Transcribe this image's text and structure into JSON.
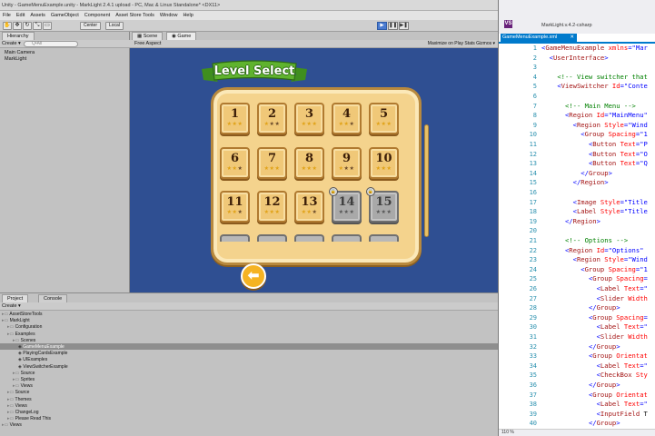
{
  "unity": {
    "window_title": "Unity - GameMenuExample.unity - MarkLight 2.4.1 upload - PC, Mac & Linux Standalone* <DX11>",
    "menu": [
      "File",
      "Edit",
      "Assets",
      "GameObject",
      "Component",
      "Asset Store Tools",
      "Window",
      "Help"
    ],
    "toolbar": {
      "tools": [
        "✋",
        "✥",
        "↻",
        "⤡",
        "▭"
      ],
      "pivot_label": "Center",
      "space_label": "Local",
      "play_buttons": [
        "▶",
        "❚❚",
        "▶❚"
      ]
    },
    "hierarchy": {
      "tab": "Hierarchy",
      "create": "Create ▾",
      "search_placeholder": "Q•All",
      "items": [
        "Main Camera",
        "MarkLight"
      ]
    },
    "scene_tab": "Scene",
    "game_tab": "Game",
    "aspect": "Free Aspect",
    "game_toolbar_right": "Maximize on Play  Stats  Gizmos ▾",
    "level_select": {
      "title": "Level Select",
      "levels": [
        {
          "num": "1",
          "stars": 3,
          "locked": false
        },
        {
          "num": "2",
          "stars": 1,
          "locked": false
        },
        {
          "num": "3",
          "stars": 3,
          "locked": false
        },
        {
          "num": "4",
          "stars": 2,
          "locked": false
        },
        {
          "num": "5",
          "stars": 3,
          "locked": false
        },
        {
          "num": "6",
          "stars": 2,
          "locked": false
        },
        {
          "num": "7",
          "stars": 3,
          "locked": false
        },
        {
          "num": "8",
          "stars": 3,
          "locked": false
        },
        {
          "num": "9",
          "stars": 1,
          "locked": false
        },
        {
          "num": "10",
          "stars": 3,
          "locked": false
        },
        {
          "num": "11",
          "stars": 2,
          "locked": false
        },
        {
          "num": "12",
          "stars": 3,
          "locked": false
        },
        {
          "num": "13",
          "stars": 2,
          "locked": false
        },
        {
          "num": "14",
          "stars": 0,
          "locked": true
        },
        {
          "num": "15",
          "stars": 0,
          "locked": true
        }
      ],
      "back_arrow": "⬅"
    },
    "project": {
      "tab_project": "Project",
      "tab_console": "Console",
      "create": "Create ▾",
      "tree": [
        {
          "label": "AssetStoreTools",
          "indent": 0
        },
        {
          "label": "MarkLight",
          "indent": 0
        },
        {
          "label": "Configuration",
          "indent": 1
        },
        {
          "label": "Examples",
          "indent": 1
        },
        {
          "label": "Scenes",
          "indent": 2
        },
        {
          "label": "GameMenuExample",
          "indent": 3
        },
        {
          "label": "PlayingCardsExample",
          "indent": 3
        },
        {
          "label": "UIExamples",
          "indent": 3
        },
        {
          "label": "ViewSwitcherExample",
          "indent": 3
        },
        {
          "label": "Source",
          "indent": 2
        },
        {
          "label": "Sprites",
          "indent": 2
        },
        {
          "label": "Views",
          "indent": 2
        },
        {
          "label": "Source",
          "indent": 1
        },
        {
          "label": "Themes",
          "indent": 1
        },
        {
          "label": "Views",
          "indent": 1
        },
        {
          "label": "ChangeLog",
          "indent": 1
        },
        {
          "label": "Please Read This",
          "indent": 1
        },
        {
          "label": "Views",
          "indent": 0
        }
      ]
    }
  },
  "vs": {
    "window_title": "MarkLight.v.4.2-csharp",
    "logo": "VS",
    "file_tab": "GameMenuExample.xml",
    "zoom": "110 %",
    "lines": [
      {
        "n": "1",
        "indent": "",
        "parts": [
          [
            "br",
            "<"
          ],
          [
            "tag",
            "GameMenuExample"
          ],
          [
            "txt",
            " "
          ],
          [
            "attr",
            "xmlns"
          ],
          [
            "br",
            "=\"Mar"
          ]
        ]
      },
      {
        "n": "2",
        "indent": "  ",
        "parts": [
          [
            "br",
            "<"
          ],
          [
            "tag",
            "UserInterface"
          ],
          [
            "br",
            ">"
          ]
        ]
      },
      {
        "n": "3",
        "indent": "",
        "parts": []
      },
      {
        "n": "4",
        "indent": "    ",
        "parts": [
          [
            "com",
            "<!-- View switcher that"
          ]
        ]
      },
      {
        "n": "5",
        "indent": "    ",
        "parts": [
          [
            "br",
            "<"
          ],
          [
            "tag",
            "ViewSwitcher"
          ],
          [
            "txt",
            " "
          ],
          [
            "attr",
            "Id"
          ],
          [
            "br",
            "=\"Conte"
          ]
        ]
      },
      {
        "n": "6",
        "indent": "",
        "parts": []
      },
      {
        "n": "7",
        "indent": "      ",
        "parts": [
          [
            "com",
            "<!-- Main Menu -->"
          ]
        ]
      },
      {
        "n": "8",
        "indent": "      ",
        "parts": [
          [
            "br",
            "<"
          ],
          [
            "tag",
            "Region"
          ],
          [
            "txt",
            " "
          ],
          [
            "attr",
            "Id"
          ],
          [
            "br",
            "=\"MainMenu\""
          ]
        ]
      },
      {
        "n": "9",
        "indent": "        ",
        "parts": [
          [
            "br",
            "<"
          ],
          [
            "tag",
            "Region"
          ],
          [
            "txt",
            " "
          ],
          [
            "attr",
            "Style"
          ],
          [
            "br",
            "=\"Wind"
          ]
        ]
      },
      {
        "n": "10",
        "indent": "          ",
        "parts": [
          [
            "br",
            "<"
          ],
          [
            "tag",
            "Group"
          ],
          [
            "txt",
            " "
          ],
          [
            "attr",
            "Spacing"
          ],
          [
            "br",
            "=\"1"
          ]
        ]
      },
      {
        "n": "11",
        "indent": "            ",
        "parts": [
          [
            "br",
            "<"
          ],
          [
            "tag",
            "Button"
          ],
          [
            "txt",
            " "
          ],
          [
            "attr",
            "Text"
          ],
          [
            "br",
            "=\"P"
          ]
        ]
      },
      {
        "n": "12",
        "indent": "            ",
        "parts": [
          [
            "br",
            "<"
          ],
          [
            "tag",
            "Button"
          ],
          [
            "txt",
            " "
          ],
          [
            "attr",
            "Text"
          ],
          [
            "br",
            "=\"O"
          ]
        ]
      },
      {
        "n": "13",
        "indent": "            ",
        "parts": [
          [
            "br",
            "<"
          ],
          [
            "tag",
            "Button"
          ],
          [
            "txt",
            " "
          ],
          [
            "attr",
            "Text"
          ],
          [
            "br",
            "=\"Q"
          ]
        ]
      },
      {
        "n": "14",
        "indent": "          ",
        "parts": [
          [
            "br",
            "</"
          ],
          [
            "tag",
            "Group"
          ],
          [
            "br",
            ">"
          ]
        ]
      },
      {
        "n": "15",
        "indent": "        ",
        "parts": [
          [
            "br",
            "</"
          ],
          [
            "tag",
            "Region"
          ],
          [
            "br",
            ">"
          ]
        ]
      },
      {
        "n": "16",
        "indent": "",
        "parts": []
      },
      {
        "n": "17",
        "indent": "        ",
        "parts": [
          [
            "br",
            "<"
          ],
          [
            "tag",
            "Image"
          ],
          [
            "txt",
            " "
          ],
          [
            "attr",
            "Style"
          ],
          [
            "br",
            "=\"Title"
          ]
        ]
      },
      {
        "n": "18",
        "indent": "        ",
        "parts": [
          [
            "br",
            "<"
          ],
          [
            "tag",
            "Label"
          ],
          [
            "txt",
            " "
          ],
          [
            "attr",
            "Style"
          ],
          [
            "br",
            "=\"Title"
          ]
        ]
      },
      {
        "n": "19",
        "indent": "      ",
        "parts": [
          [
            "br",
            "</"
          ],
          [
            "tag",
            "Region"
          ],
          [
            "br",
            ">"
          ]
        ]
      },
      {
        "n": "20",
        "indent": "",
        "parts": []
      },
      {
        "n": "21",
        "indent": "      ",
        "parts": [
          [
            "com",
            "<!-- Options -->"
          ]
        ]
      },
      {
        "n": "22",
        "indent": "      ",
        "parts": [
          [
            "br",
            "<"
          ],
          [
            "tag",
            "Region"
          ],
          [
            "txt",
            " "
          ],
          [
            "attr",
            "Id"
          ],
          [
            "br",
            "=\"Options\""
          ]
        ]
      },
      {
        "n": "23",
        "indent": "        ",
        "parts": [
          [
            "br",
            "<"
          ],
          [
            "tag",
            "Region"
          ],
          [
            "txt",
            " "
          ],
          [
            "attr",
            "Style"
          ],
          [
            "br",
            "=\"Wind"
          ]
        ]
      },
      {
        "n": "24",
        "indent": "          ",
        "parts": [
          [
            "br",
            "<"
          ],
          [
            "tag",
            "Group"
          ],
          [
            "txt",
            " "
          ],
          [
            "attr",
            "Spacing"
          ],
          [
            "br",
            "=\"1"
          ]
        ]
      },
      {
        "n": "25",
        "indent": "            ",
        "parts": [
          [
            "br",
            "<"
          ],
          [
            "tag",
            "Group"
          ],
          [
            "txt",
            " "
          ],
          [
            "attr",
            "Spacing"
          ],
          [
            "br",
            "="
          ]
        ]
      },
      {
        "n": "26",
        "indent": "              ",
        "parts": [
          [
            "br",
            "<"
          ],
          [
            "tag",
            "Label"
          ],
          [
            "txt",
            " "
          ],
          [
            "attr",
            "Text"
          ],
          [
            "br",
            "=\""
          ]
        ]
      },
      {
        "n": "27",
        "indent": "              ",
        "parts": [
          [
            "br",
            "<"
          ],
          [
            "tag",
            "Slider"
          ],
          [
            "txt",
            " "
          ],
          [
            "attr",
            "Width"
          ]
        ]
      },
      {
        "n": "28",
        "indent": "            ",
        "parts": [
          [
            "br",
            "</"
          ],
          [
            "tag",
            "Group"
          ],
          [
            "br",
            ">"
          ]
        ]
      },
      {
        "n": "29",
        "indent": "            ",
        "parts": [
          [
            "br",
            "<"
          ],
          [
            "tag",
            "Group"
          ],
          [
            "txt",
            " "
          ],
          [
            "attr",
            "Spacing"
          ],
          [
            "br",
            "="
          ]
        ]
      },
      {
        "n": "30",
        "indent": "              ",
        "parts": [
          [
            "br",
            "<"
          ],
          [
            "tag",
            "Label"
          ],
          [
            "txt",
            " "
          ],
          [
            "attr",
            "Text"
          ],
          [
            "br",
            "=\""
          ]
        ]
      },
      {
        "n": "31",
        "indent": "              ",
        "parts": [
          [
            "br",
            "<"
          ],
          [
            "tag",
            "Slider"
          ],
          [
            "txt",
            " "
          ],
          [
            "attr",
            "Width"
          ]
        ]
      },
      {
        "n": "32",
        "indent": "            ",
        "parts": [
          [
            "br",
            "</"
          ],
          [
            "tag",
            "Group"
          ],
          [
            "br",
            ">"
          ]
        ]
      },
      {
        "n": "33",
        "indent": "            ",
        "parts": [
          [
            "br",
            "<"
          ],
          [
            "tag",
            "Group"
          ],
          [
            "txt",
            " "
          ],
          [
            "attr",
            "Orientat"
          ]
        ]
      },
      {
        "n": "34",
        "indent": "              ",
        "parts": [
          [
            "br",
            "<"
          ],
          [
            "tag",
            "Label"
          ],
          [
            "txt",
            " "
          ],
          [
            "attr",
            "Text"
          ],
          [
            "br",
            "=\""
          ]
        ]
      },
      {
        "n": "35",
        "indent": "              ",
        "parts": [
          [
            "br",
            "<"
          ],
          [
            "tag",
            "CheckBox"
          ],
          [
            "txt",
            " "
          ],
          [
            "attr",
            "Sty"
          ]
        ]
      },
      {
        "n": "36",
        "indent": "            ",
        "parts": [
          [
            "br",
            "</"
          ],
          [
            "tag",
            "Group"
          ],
          [
            "br",
            ">"
          ]
        ]
      },
      {
        "n": "37",
        "indent": "            ",
        "parts": [
          [
            "br",
            "<"
          ],
          [
            "tag",
            "Group"
          ],
          [
            "txt",
            " "
          ],
          [
            "attr",
            "Orientat"
          ]
        ]
      },
      {
        "n": "38",
        "indent": "              ",
        "parts": [
          [
            "br",
            "<"
          ],
          [
            "tag",
            "Label"
          ],
          [
            "txt",
            " "
          ],
          [
            "attr",
            "Text"
          ],
          [
            "br",
            "=\""
          ]
        ]
      },
      {
        "n": "39",
        "indent": "              ",
        "parts": [
          [
            "br",
            "<"
          ],
          [
            "tag",
            "InputField"
          ],
          [
            "txt",
            " T"
          ]
        ]
      },
      {
        "n": "40",
        "indent": "            ",
        "parts": [
          [
            "br",
            "</"
          ],
          [
            "tag",
            "Group"
          ],
          [
            "br",
            ">"
          ]
        ]
      }
    ]
  },
  "colors": {
    "game_bg": "#2f4f92",
    "vs_accent": "#007acc",
    "star_gold": "#e0a217",
    "banner_green": "#5fb32e"
  }
}
